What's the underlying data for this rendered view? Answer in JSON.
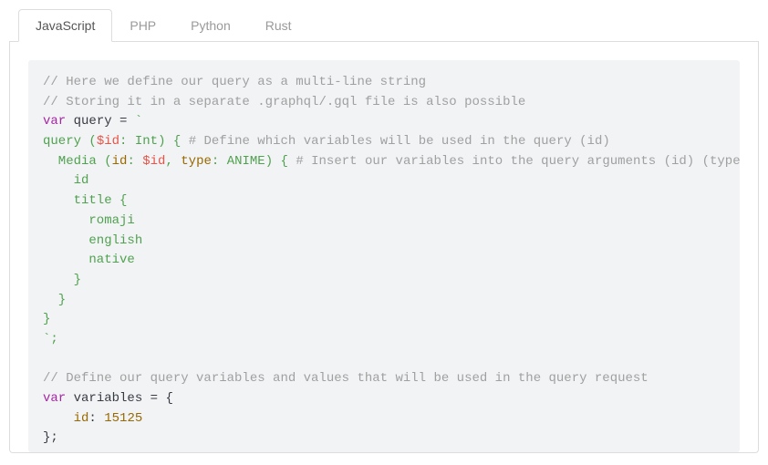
{
  "tabs": [
    {
      "label": "JavaScript",
      "active": true
    },
    {
      "label": "PHP",
      "active": false
    },
    {
      "label": "Python",
      "active": false
    },
    {
      "label": "Rust",
      "active": false
    }
  ],
  "code": {
    "c1": "// Here we define our query as a multi-line string",
    "c2": "// Storing it in a separate .graphql/.gql file is also possible",
    "kw_var": "var",
    "id_query": " query ",
    "eq": "= ",
    "bt": "`",
    "q_head": "query ",
    "q_paren_o": "(",
    "q_var": "$id",
    "q_colon": ": ",
    "q_type": "Int",
    "q_paren_c": ") { ",
    "q_c1": "# Define which variables will be used in the query (id)",
    "q_media": "  Media ",
    "q_media_args_o": "(",
    "q_media_id": "id",
    "q_media_colon": ": ",
    "q_media_var": "$id",
    "q_media_comma": ", ",
    "q_media_typek": "type",
    "q_media_type": "ANIME",
    "q_media_args_c": ") { ",
    "q_c2": "# Insert our variables into the query arguments (id) (type",
    "q_f_id": "    id",
    "q_f_title": "    title {",
    "q_f_romaji": "      romaji",
    "q_f_english": "      english",
    "q_f_native": "      native",
    "q_close_title": "    }",
    "q_close_media": "  }",
    "q_close_query": "}",
    "bt_end": "`;",
    "blank": " ",
    "c3": "// Define our query variables and values that will be used in the query request",
    "id_variables": " variables ",
    "obj_open": "= {",
    "obj_id_key": "    id",
    "obj_colon": ": ",
    "obj_id_val": "15125",
    "obj_close": "};"
  },
  "chart_data": null
}
